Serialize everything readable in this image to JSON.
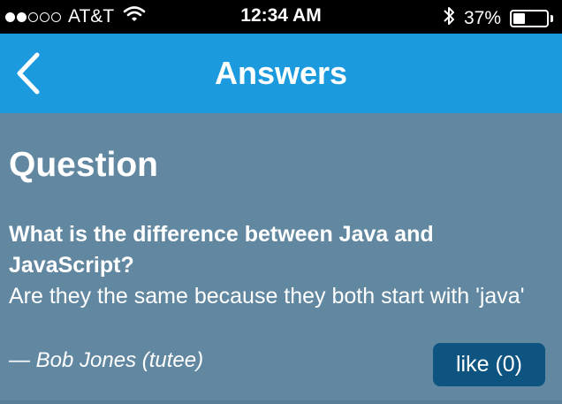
{
  "status_bar": {
    "signal_dots_filled": 2,
    "signal_dots_total": 5,
    "carrier": "AT&T",
    "time": "12:34 AM",
    "battery_text": "37%",
    "battery_level": 0.37,
    "icons": [
      "wifi-icon",
      "bluetooth-icon",
      "battery-icon"
    ]
  },
  "nav": {
    "title": "Answers",
    "back_icon": "chevron-left-icon"
  },
  "question": {
    "heading": "Question",
    "title": "What is the difference between Java and JavaScript?",
    "body": "Are they the same because they both start with 'java'",
    "author": "— Bob Jones (tutee)",
    "like_label": "like (0)"
  },
  "colors": {
    "status_bar": "#000000",
    "nav_bar": "#1c9ade",
    "background": "#6288a1",
    "like_button": "#0d5580",
    "text": "#ffffff"
  }
}
